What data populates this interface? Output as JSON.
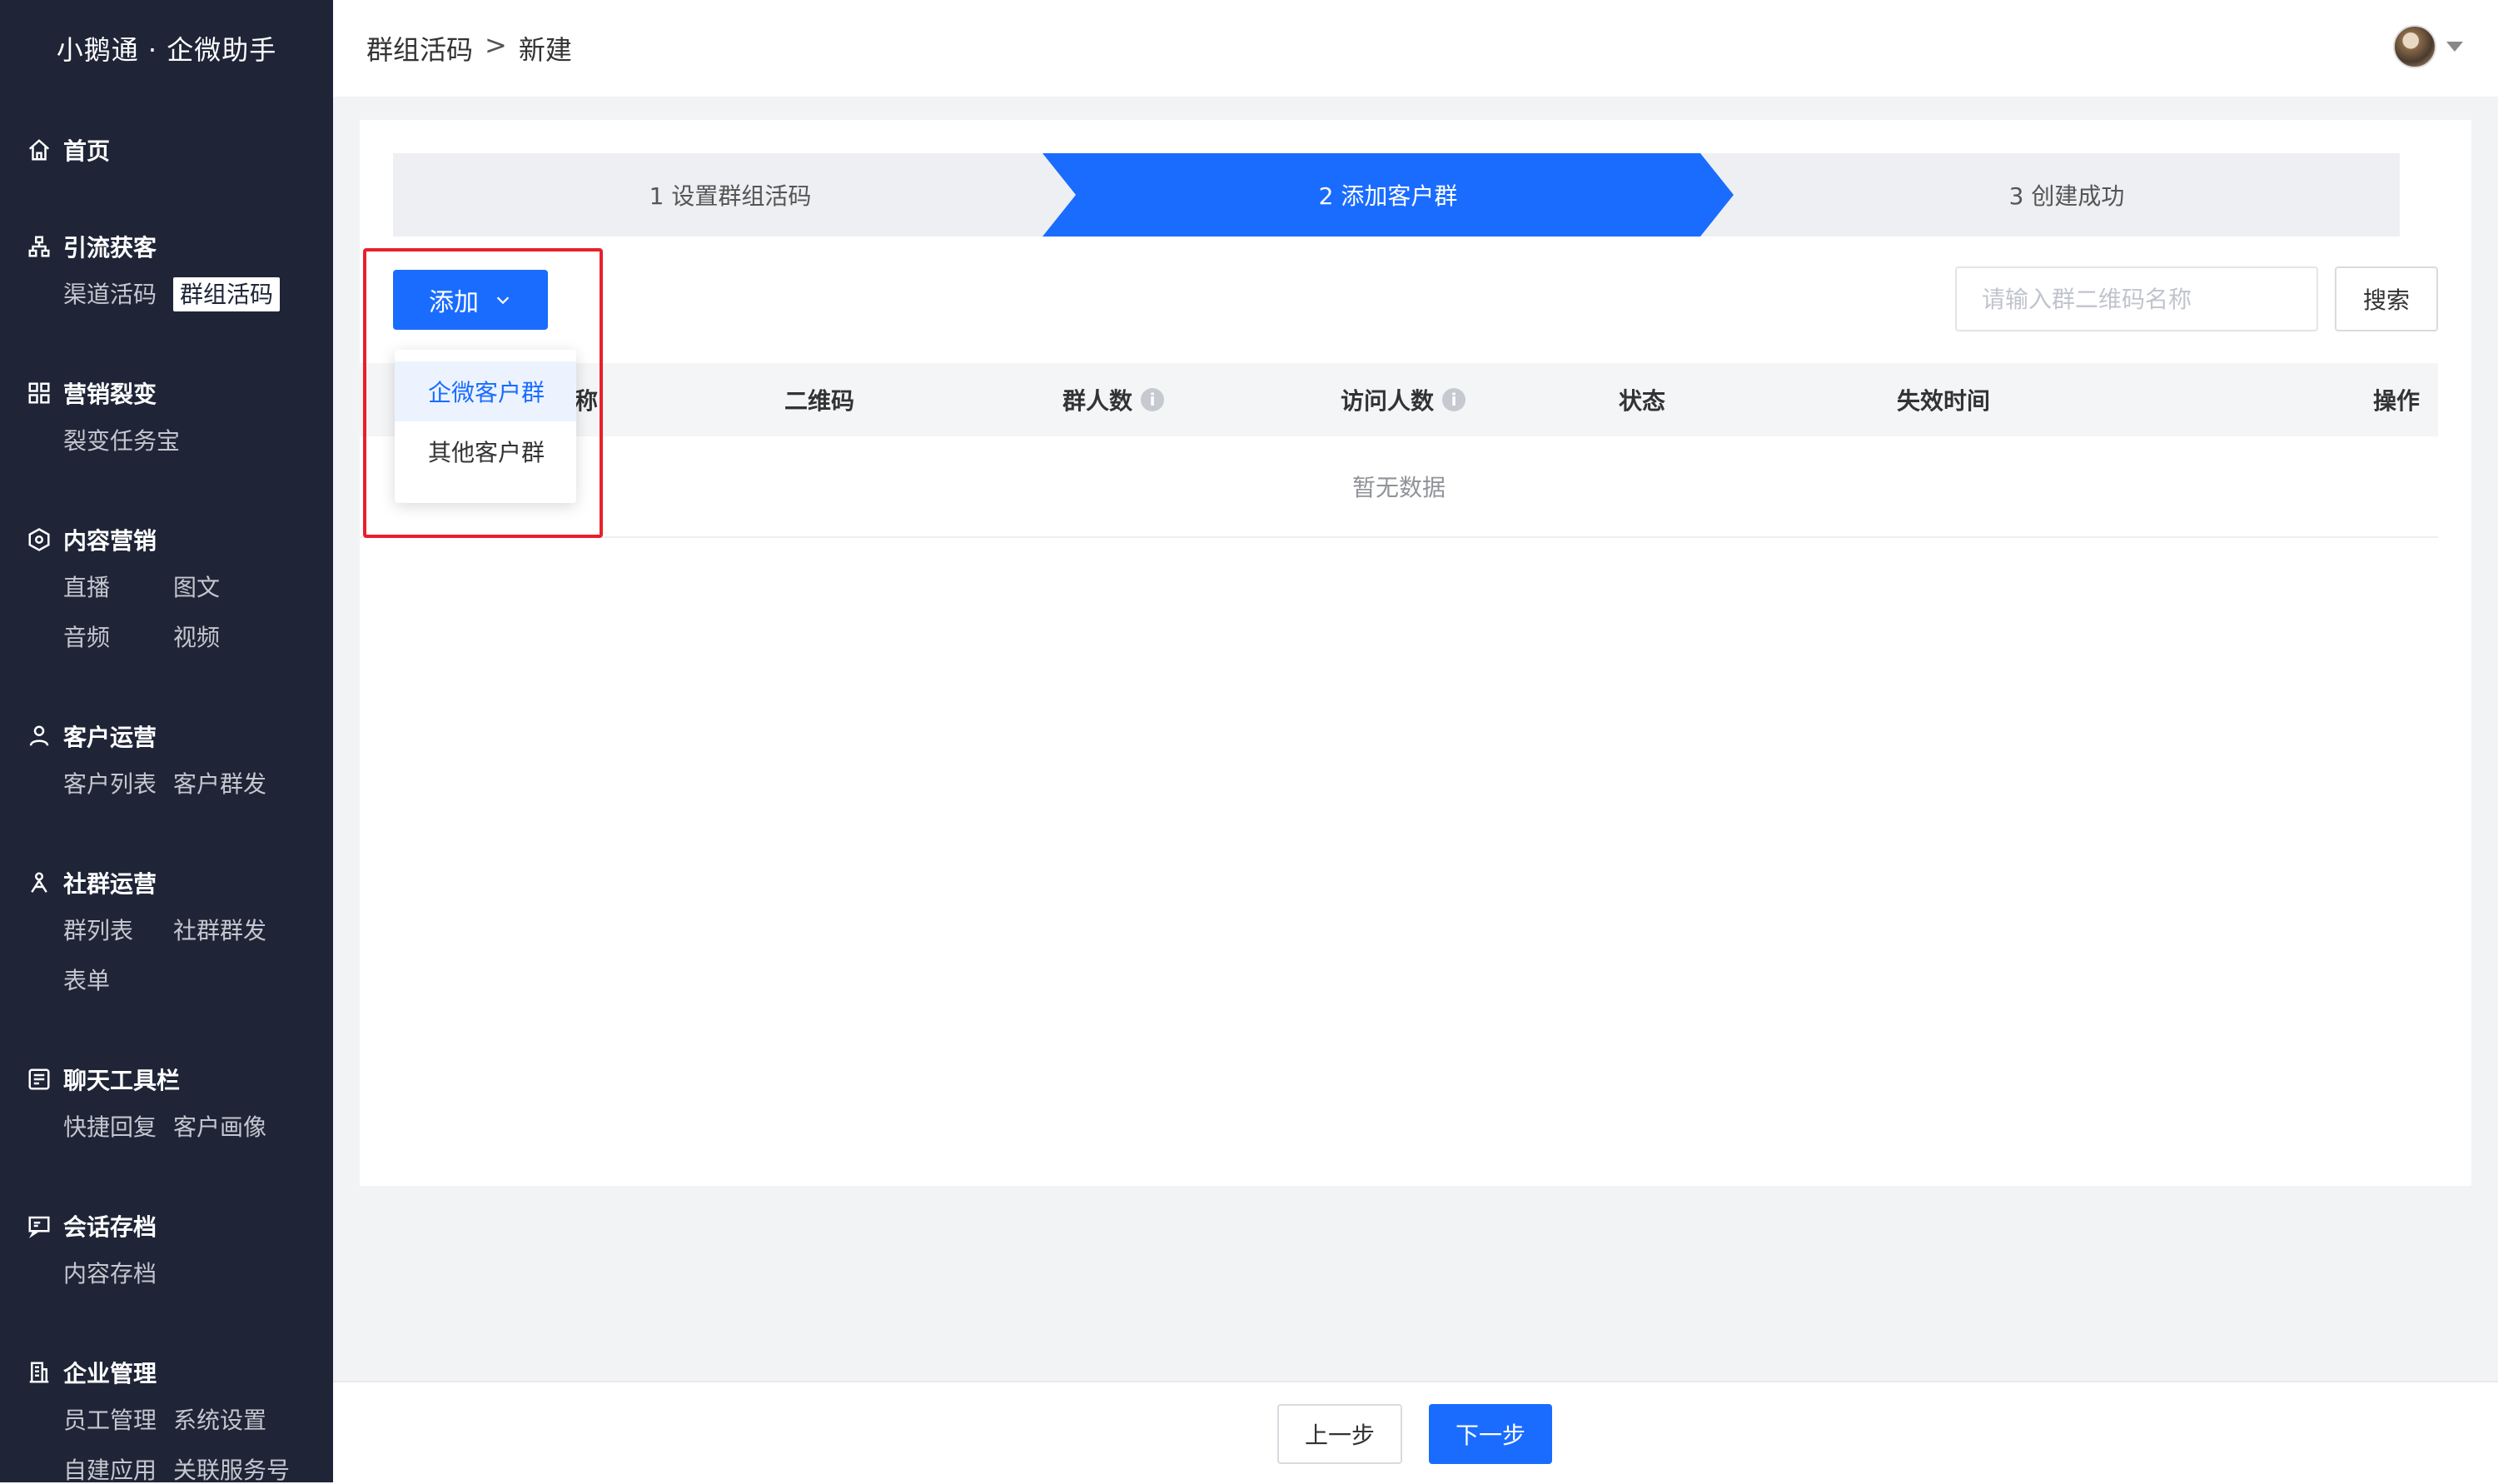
{
  "sidebar": {
    "brand": "小鹅通 · 企微助手",
    "groups": [
      {
        "title": "首页",
        "icon": "home-icon",
        "items": []
      },
      {
        "title": "引流获客",
        "icon": "network-icon",
        "items": [
          "渠道活码",
          "群组活码"
        ]
      },
      {
        "title": "营销裂变",
        "icon": "hierarchy-icon",
        "items": [
          "裂变任务宝"
        ]
      },
      {
        "title": "内容营销",
        "icon": "hexagon-icon",
        "items": [
          "直播",
          "图文",
          "音频",
          "视频"
        ]
      },
      {
        "title": "客户运营",
        "icon": "person-icon",
        "items": [
          "客户列表",
          "客户群发"
        ]
      },
      {
        "title": "社群运营",
        "icon": "group-icon",
        "items": [
          "群列表",
          "社群群发",
          "表单"
        ]
      },
      {
        "title": "聊天工具栏",
        "icon": "toolbar-icon",
        "items": [
          "快捷回复",
          "客户画像"
        ]
      },
      {
        "title": "会话存档",
        "icon": "chat-archive-icon",
        "items": [
          "内容存档"
        ]
      },
      {
        "title": "企业管理",
        "icon": "building-icon",
        "items": [
          "员工管理",
          "系统设置",
          "自建应用",
          "关联服务号"
        ]
      }
    ]
  },
  "header": {
    "breadcrumb": [
      "群组活码",
      ">",
      "新建"
    ]
  },
  "steps": [
    "1 设置群组活码",
    "2 添加客户群",
    "3 创建成功"
  ],
  "toolbar": {
    "add_label": "添加",
    "search_placeholder": "请输入群二维码名称",
    "search_label": "搜索"
  },
  "dropdown": [
    "企微客户群",
    "其他客户群"
  ],
  "table": {
    "columns": [
      "名称",
      "二维码",
      "群人数",
      "访问人数",
      "状态",
      "失效时间",
      "操作"
    ],
    "empty_text": "暂无数据"
  },
  "footer": {
    "prev_label": "上一步",
    "next_label": "下一步"
  },
  "colors": {
    "sidebar_bg": "#1f2537",
    "primary": "#1a6cff",
    "highlight": "#e8202a"
  }
}
